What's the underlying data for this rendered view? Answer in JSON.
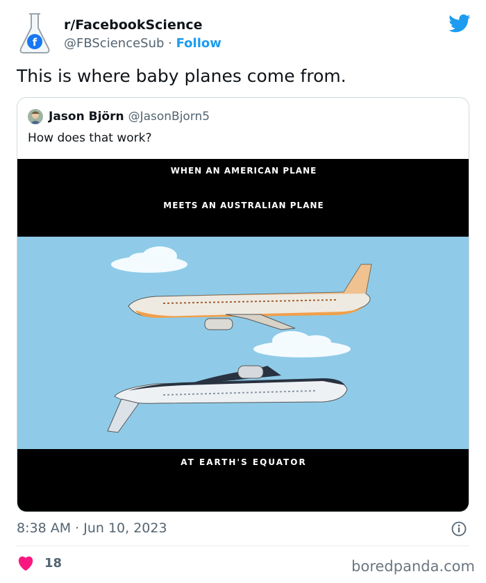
{
  "tweet": {
    "display_name": "r/FacebookScience",
    "handle": "@FBScienceSub",
    "separator": " · ",
    "follow_label": "Follow",
    "text": "This is where baby planes come from.",
    "timestamp": "8:38 AM · Jun 10, 2023",
    "like_count": "18"
  },
  "quoted_tweet": {
    "display_name": "Jason Björn",
    "handle": "@JasonBjorn5",
    "text": "How does that work?",
    "meme": {
      "caption_line1": "WHEN AN AMERICAN PLANE",
      "caption_line2": "MEETS AN AUSTRALIAN PLANE",
      "caption_bottom": "AT EARTH'S EQUATOR"
    }
  },
  "watermark": "boredpanda.com",
  "colors": {
    "twitter_blue": "#1d9bf0",
    "heart_red": "#f91880",
    "secondary_text": "#536471",
    "sky": "#8fcbe8"
  },
  "icons": [
    "flask-facebook-icon",
    "twitter-bird-icon",
    "info-icon",
    "heart-icon"
  ]
}
